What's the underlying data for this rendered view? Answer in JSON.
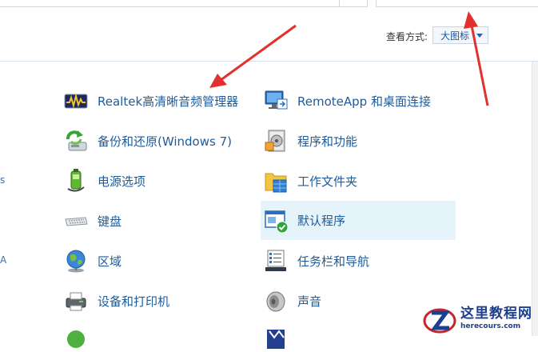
{
  "header": {
    "view_label": "查看方式:",
    "view_value": "大图标"
  },
  "edge_marks": [
    "s",
    "A"
  ],
  "left_items": [
    {
      "label": "Realtek高清晰音频管理器",
      "icon": "realtek-audio-icon"
    },
    {
      "label": "备份和还原(Windows 7)",
      "icon": "backup-restore-icon"
    },
    {
      "label": "电源选项",
      "icon": "power-options-icon"
    },
    {
      "label": "键盘",
      "icon": "keyboard-icon"
    },
    {
      "label": "区域",
      "icon": "region-globe-icon"
    },
    {
      "label": "设备和打印机",
      "icon": "devices-printers-icon"
    }
  ],
  "right_items": [
    {
      "label": "RemoteApp 和桌面连接",
      "icon": "remoteapp-icon"
    },
    {
      "label": "程序和功能",
      "icon": "programs-features-icon"
    },
    {
      "label": "工作文件夹",
      "icon": "work-folders-icon"
    },
    {
      "label": "默认程序",
      "icon": "default-programs-icon"
    },
    {
      "label": "任务栏和导航",
      "icon": "taskbar-navigation-icon"
    },
    {
      "label": "声音",
      "icon": "sound-speaker-icon"
    }
  ],
  "watermark": {
    "title": "这里教程网",
    "url": "herecours.com"
  },
  "colors": {
    "link": "#1e5b9b",
    "selected_bg": "#e5f3fb",
    "arrow": "#e2312d"
  }
}
